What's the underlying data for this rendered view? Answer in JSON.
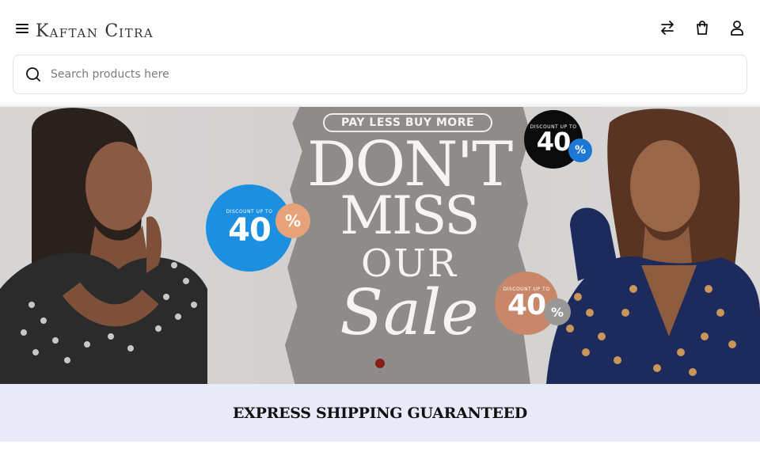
{
  "header": {
    "logo": {
      "k": "K",
      "aftan": "aftan",
      "c": "C",
      "itra": "itra"
    },
    "icons": [
      "menu-icon",
      "compare-icon",
      "shopping-bag-icon",
      "user-icon"
    ]
  },
  "search": {
    "placeholder": "Search products here",
    "value": ""
  },
  "banner": {
    "pill": "PAY LESS BUY MORE",
    "headline": {
      "line1": "DON'T",
      "line2": "MISS",
      "line3": "OUR",
      "line4": "Sale"
    },
    "badges": [
      {
        "caption": "Discount up to",
        "value": "40",
        "unit": "%"
      },
      {
        "caption": "Discount up to",
        "value": "40",
        "unit": "%"
      },
      {
        "caption": "Discount up to",
        "value": "40",
        "unit": "%"
      }
    ],
    "slide_count": 1,
    "active_slide": 1
  },
  "shipping": {
    "text": "EXPRESS SHIPPING GUARANTEED"
  },
  "colors": {
    "accent_dot": "#8b1a1a",
    "shipping_bg": "#e8eaf9",
    "badge_blue": "#1c8fe0",
    "badge_brown": "#c9876a",
    "badge_black": "#0b0b0b"
  }
}
